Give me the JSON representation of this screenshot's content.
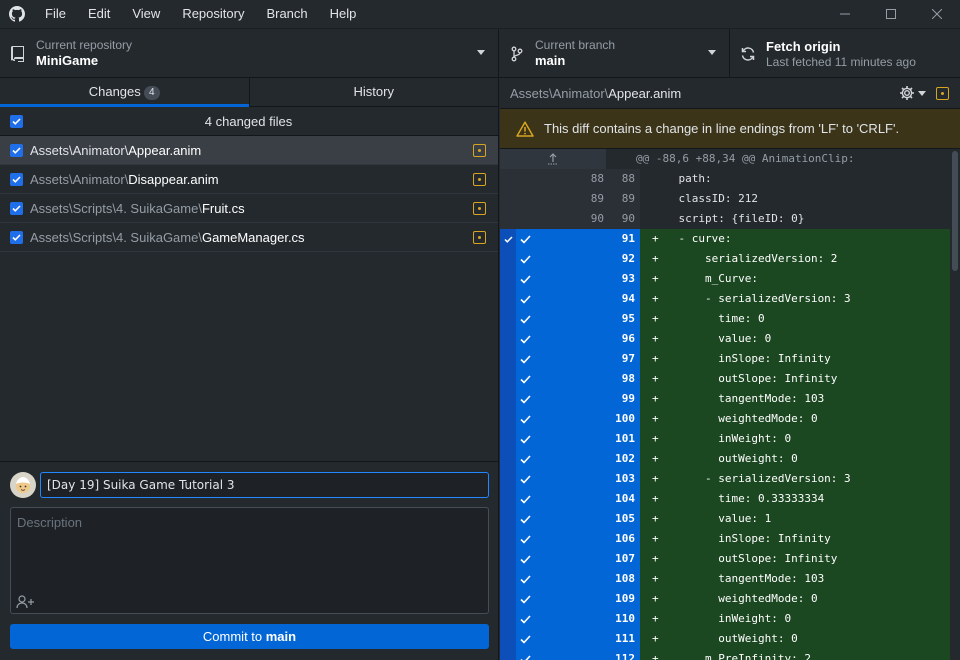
{
  "menu": [
    "File",
    "Edit",
    "View",
    "Repository",
    "Branch",
    "Help"
  ],
  "toolbar": {
    "repo_label": "Current repository",
    "repo_value": "MiniGame",
    "branch_label": "Current branch",
    "branch_value": "main",
    "fetch_label": "Fetch origin",
    "fetch_sub": "Last fetched 11 minutes ago"
  },
  "tabs": {
    "changes": "Changes",
    "changes_count": "4",
    "history": "History"
  },
  "changed_header": "4 changed files",
  "files": [
    {
      "dir": "Assets\\Animator\\",
      "name": "Appear.anim",
      "selected": true
    },
    {
      "dir": "Assets\\Animator\\",
      "name": "Disappear.anim",
      "selected": false
    },
    {
      "dir": "Assets\\Scripts\\4. SuikaGame\\",
      "name": "Fruit.cs",
      "selected": false
    },
    {
      "dir": "Assets\\Scripts\\4. SuikaGame\\",
      "name": "GameManager.cs",
      "selected": false
    }
  ],
  "commit": {
    "summary": "[Day 19] Suika Game Tutorial 3",
    "description_placeholder": "Description",
    "button_prefix": "Commit to ",
    "button_branch": "main"
  },
  "diff": {
    "path_dir": "Assets\\Animator\\",
    "path_name": "Appear.anim",
    "warning": "This diff contains a change in line endings from 'LF' to 'CRLF'.",
    "hunk": "@@ -88,6 +88,34 @@ AnimationClip:",
    "lines": [
      {
        "type": "ctx",
        "old": "88",
        "new": "88",
        "text": "    path:"
      },
      {
        "type": "ctx",
        "old": "89",
        "new": "89",
        "text": "    classID: 212"
      },
      {
        "type": "ctx",
        "old": "90",
        "new": "90",
        "text": "    script: {fileID: 0}"
      },
      {
        "type": "add",
        "old": "",
        "new": "91",
        "text": "+   - curve:"
      },
      {
        "type": "add",
        "old": "",
        "new": "92",
        "text": "+       serializedVersion: 2"
      },
      {
        "type": "add",
        "old": "",
        "new": "93",
        "text": "+       m_Curve:"
      },
      {
        "type": "add",
        "old": "",
        "new": "94",
        "text": "+       - serializedVersion: 3"
      },
      {
        "type": "add",
        "old": "",
        "new": "95",
        "text": "+         time: 0"
      },
      {
        "type": "add",
        "old": "",
        "new": "96",
        "text": "+         value: 0"
      },
      {
        "type": "add",
        "old": "",
        "new": "97",
        "text": "+         inSlope: Infinity"
      },
      {
        "type": "add",
        "old": "",
        "new": "98",
        "text": "+         outSlope: Infinity"
      },
      {
        "type": "add",
        "old": "",
        "new": "99",
        "text": "+         tangentMode: 103"
      },
      {
        "type": "add",
        "old": "",
        "new": "100",
        "text": "+         weightedMode: 0"
      },
      {
        "type": "add",
        "old": "",
        "new": "101",
        "text": "+         inWeight: 0"
      },
      {
        "type": "add",
        "old": "",
        "new": "102",
        "text": "+         outWeight: 0"
      },
      {
        "type": "add",
        "old": "",
        "new": "103",
        "text": "+       - serializedVersion: 3"
      },
      {
        "type": "add",
        "old": "",
        "new": "104",
        "text": "+         time: 0.33333334"
      },
      {
        "type": "add",
        "old": "",
        "new": "105",
        "text": "+         value: 1"
      },
      {
        "type": "add",
        "old": "",
        "new": "106",
        "text": "+         inSlope: Infinity"
      },
      {
        "type": "add",
        "old": "",
        "new": "107",
        "text": "+         outSlope: Infinity"
      },
      {
        "type": "add",
        "old": "",
        "new": "108",
        "text": "+         tangentMode: 103"
      },
      {
        "type": "add",
        "old": "",
        "new": "109",
        "text": "+         weightedMode: 0"
      },
      {
        "type": "add",
        "old": "",
        "new": "110",
        "text": "+         inWeight: 0"
      },
      {
        "type": "add",
        "old": "",
        "new": "111",
        "text": "+         outWeight: 0"
      },
      {
        "type": "add",
        "old": "",
        "new": "112",
        "text": "+       m_PreInfinity: 2"
      }
    ]
  },
  "colors": {
    "accent": "#0366d6",
    "added_bg": "#1b4721",
    "modified": "#d8a521",
    "warning_bg": "#3b3419"
  }
}
